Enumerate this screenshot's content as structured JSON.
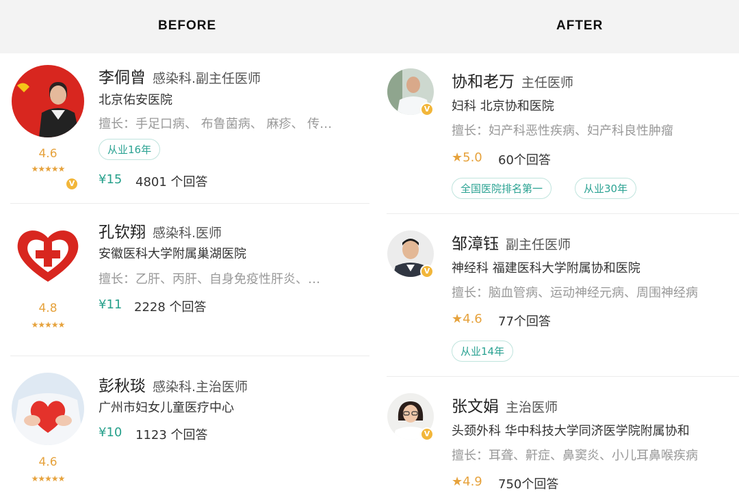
{
  "header": {
    "before": "BEFORE",
    "after": "AFTER"
  },
  "before": [
    {
      "name": "李侗曾",
      "title": "感染科.副主任医师",
      "hospital": "北京佑安医院",
      "specialty": "擅长：手足口病、 布鲁菌病、 麻疹、 传…",
      "tag": "从业16年",
      "score": "4.6",
      "stars": "★★★★★",
      "price": "¥15",
      "answers": "4801 个回答"
    },
    {
      "name": "孔钦翔",
      "title": "感染科.医师",
      "hospital": "安徽医科大学附属巢湖医院",
      "specialty": "擅长：乙肝、丙肝、自身免疫性肝炎、…",
      "score": "4.8",
      "stars": "★★★★★",
      "price": "¥11",
      "answers": "2228 个回答"
    },
    {
      "name": "彭秋琰",
      "title": "感染科.主治医师",
      "hospital": "广州市妇女儿童医疗中心",
      "score": "4.6",
      "stars": "★★★★★",
      "price": "¥10",
      "answers": "1123 个回答"
    }
  ],
  "after": [
    {
      "name": "协和老万",
      "title": "主任医师",
      "dept": "妇科  北京协和医院",
      "specialty": "擅长：妇产科恶性疾病、妇产科良性肿瘤",
      "score": "★5.0",
      "answers": "60个回答",
      "tags": [
        "全国医院排名第一",
        "从业30年"
      ]
    },
    {
      "name": "邹漳钰",
      "title": "副主任医师",
      "dept": "神经科  福建医科大学附属协和医院",
      "specialty": "擅长：脑血管病、运动神经元病、周围神经病",
      "score": "★4.6",
      "answers": "77个回答",
      "tags": [
        "从业14年"
      ]
    },
    {
      "name": "张文娟",
      "title": "主治医师",
      "dept": "头颈外科  华中科技大学同济医学院附属协和",
      "specialty": "擅长：耳聋、鼾症、鼻窦炎、小儿耳鼻喉疾病",
      "score": "★4.9",
      "answers": "750个回答"
    }
  ],
  "colors": {
    "accent": "#26a08b",
    "star": "#e6a23c",
    "badge": "#f2b63a"
  }
}
